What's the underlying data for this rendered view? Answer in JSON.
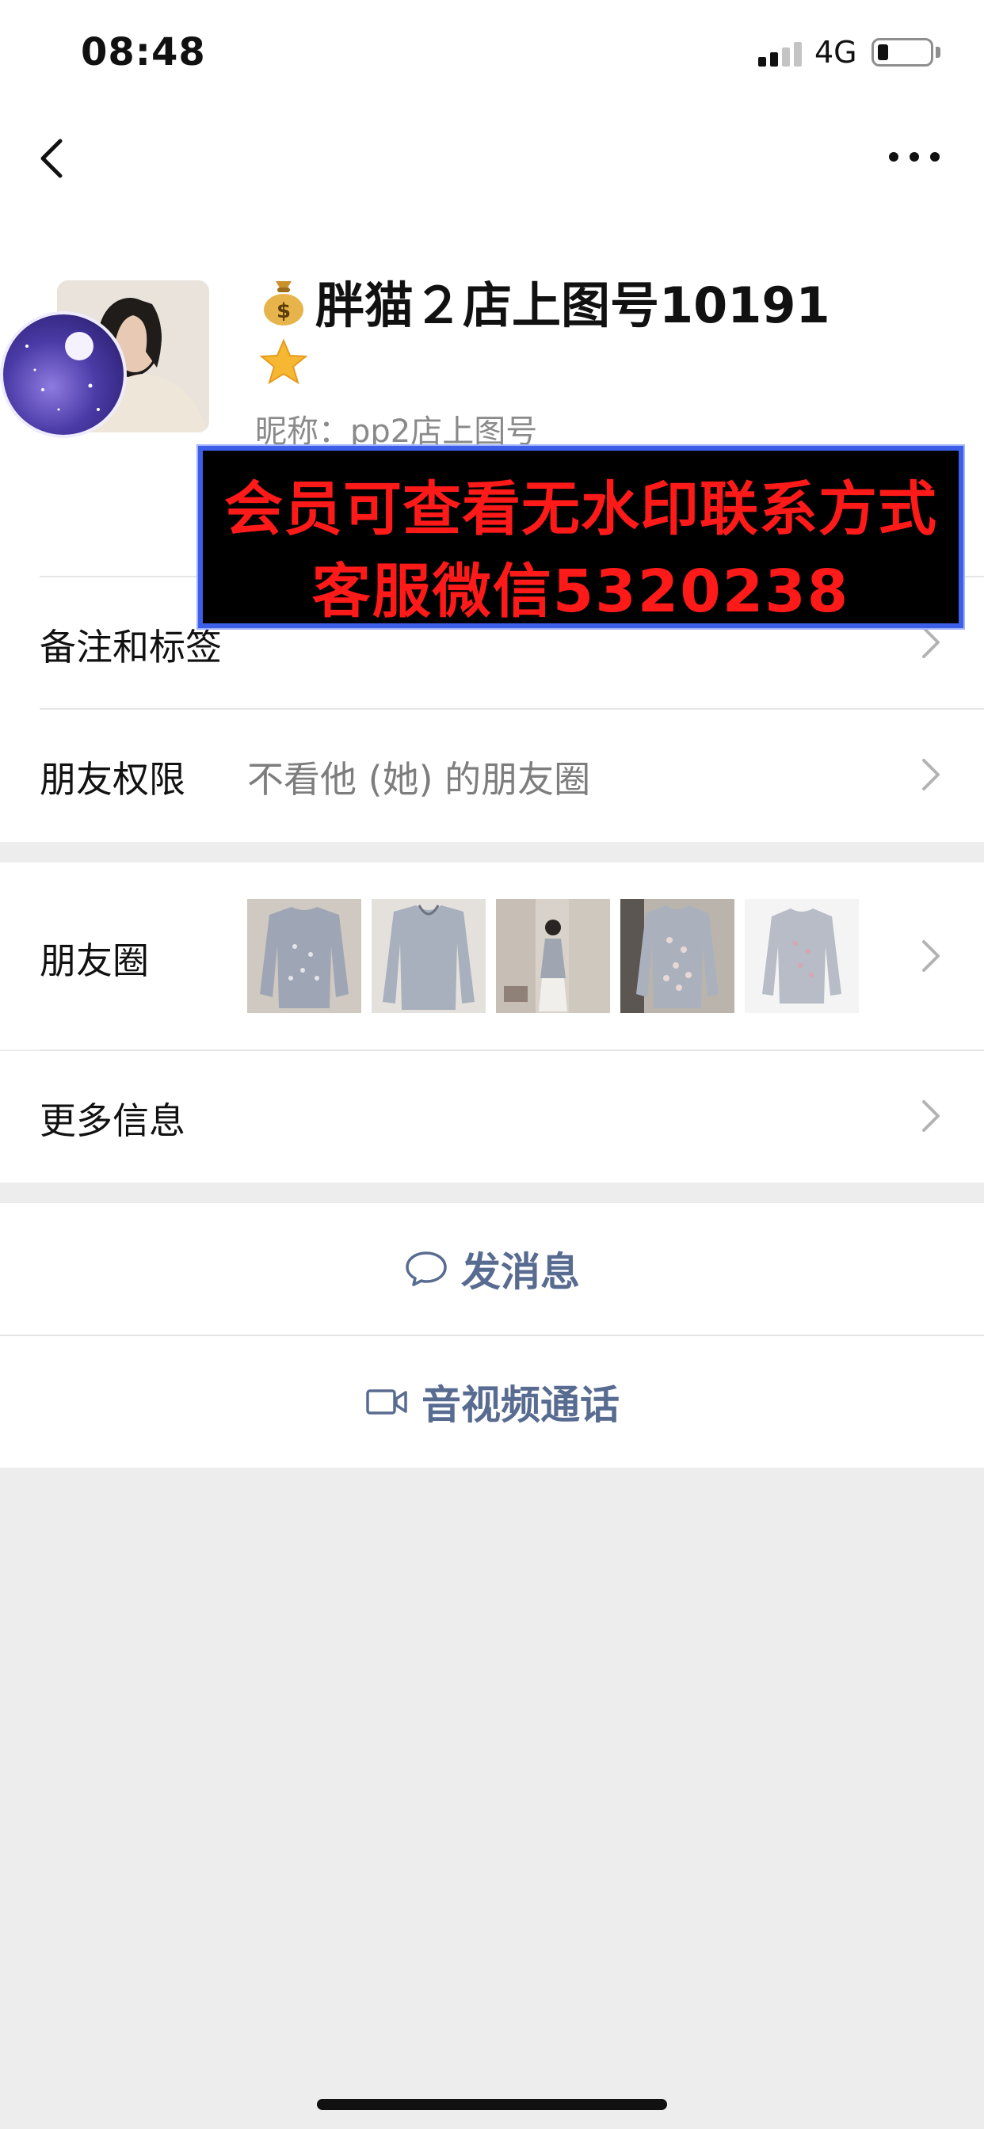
{
  "status_bar": {
    "time": "08:48",
    "network": "4G"
  },
  "profile": {
    "display_name": "胖猫２店上图号10191",
    "nickname": "昵称：pp2店上图号"
  },
  "promo_banner": {
    "line1": "会员可查看无水印联系方式",
    "line2": "客服微信5320238"
  },
  "rows": {
    "remarks": {
      "label": "备注和标签"
    },
    "permissions": {
      "label": "朋友权限",
      "value": "不看他 (她) 的朋友圈"
    },
    "moments": {
      "label": "朋友圈"
    },
    "more_info": {
      "label": "更多信息"
    }
  },
  "actions": {
    "message": {
      "label": "发消息"
    },
    "call": {
      "label": "音视频通话"
    }
  },
  "icons": {
    "back": "chevron-left-icon",
    "more": "more-dots-icon",
    "money_bag": "money-bag-icon",
    "star": "star-icon",
    "chevron": "chevron-right-icon",
    "message": "speech-bubble-icon",
    "video": "video-camera-icon"
  },
  "colors": {
    "accent_link": "#586b90",
    "promo_text": "#ff1a1a",
    "promo_border": "#3d5fe8",
    "star": "#f6b733"
  }
}
